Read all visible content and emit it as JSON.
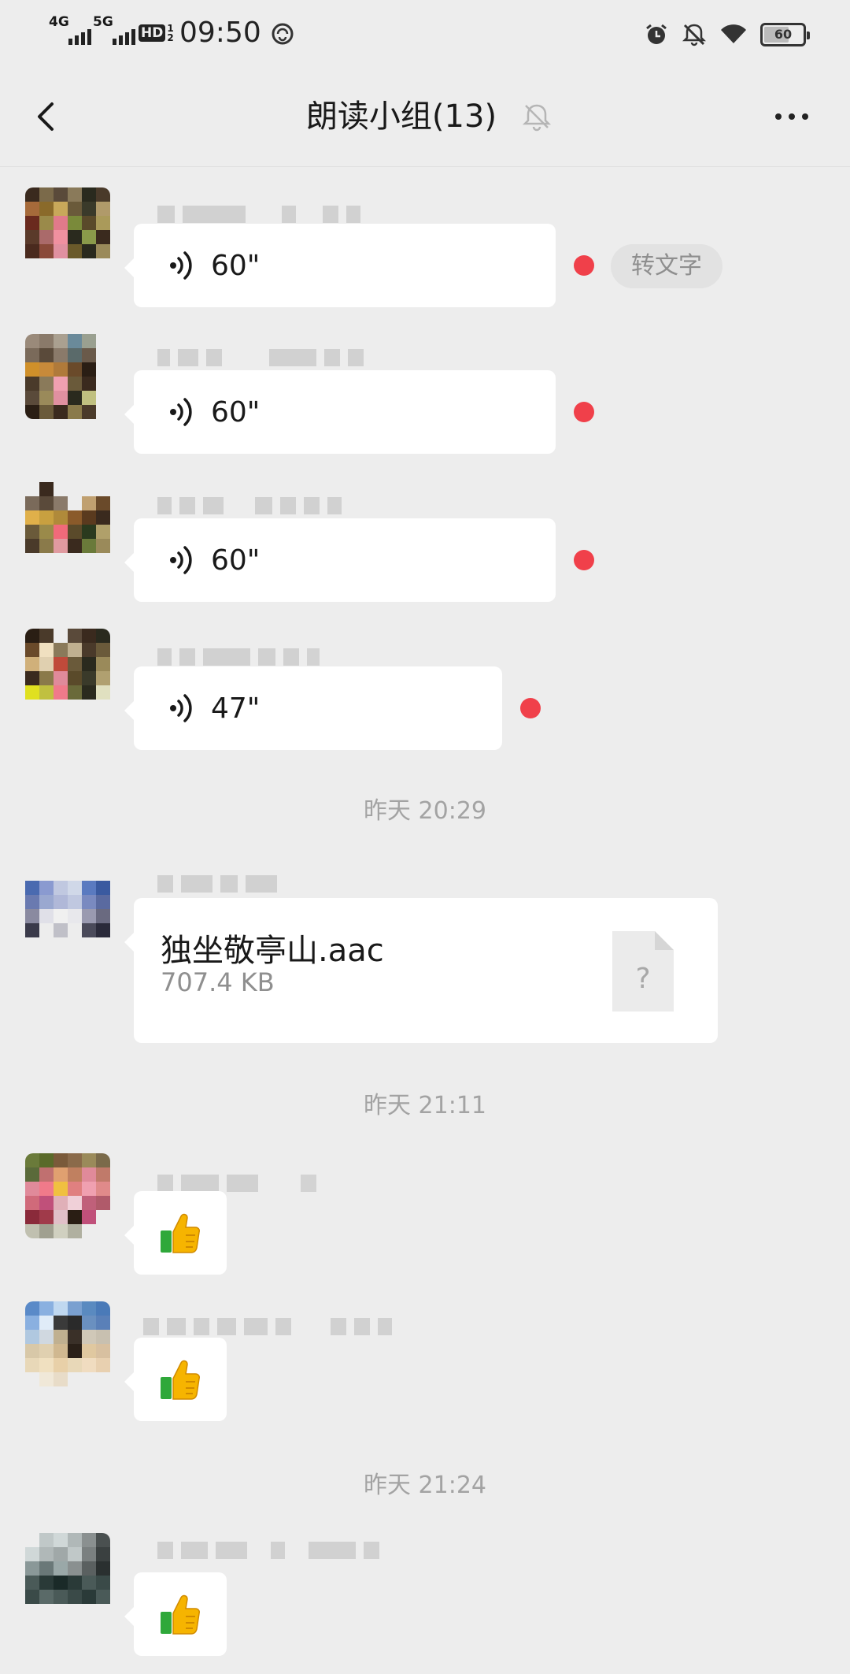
{
  "status_bar": {
    "net1": "4G",
    "net2": "5G",
    "hd": "HD",
    "hd_fraction_top": "1",
    "hd_fraction_bottom": "2",
    "time": "09:50",
    "battery_level": "60",
    "icons": [
      "alarm-icon",
      "notifications-off-icon",
      "wifi-icon",
      "battery-icon"
    ]
  },
  "nav": {
    "title": "朗读小组(13)",
    "back_icon": "chevron-left-icon",
    "mute_icon": "bell-off-icon",
    "more_icon": "more-dots-icon"
  },
  "messages": [
    {
      "type": "voice",
      "duration": "60\"",
      "unread": true,
      "action": "转文字"
    },
    {
      "type": "voice",
      "duration": "60\"",
      "unread": true
    },
    {
      "type": "voice",
      "duration": "60\"",
      "unread": true
    },
    {
      "type": "voice",
      "duration": "47\"",
      "unread": true
    },
    {
      "type": "timestamp",
      "text": "昨天 20:29"
    },
    {
      "type": "file",
      "file_name": "独坐敬亭山.aac",
      "file_size": "707.4 KB",
      "file_icon_glyph": "?"
    },
    {
      "type": "timestamp",
      "text": "昨天 21:11"
    },
    {
      "type": "emoji",
      "emoji": "thumbs-up-icon"
    },
    {
      "type": "emoji",
      "emoji": "thumbs-up-icon"
    },
    {
      "type": "timestamp",
      "text": "昨天 21:24"
    },
    {
      "type": "emoji",
      "emoji": "thumbs-up-icon"
    }
  ],
  "colors": {
    "background": "#ededed",
    "bubble": "#ffffff",
    "unread_dot": "#f0404a",
    "timestamp_text": "#a3a3a3"
  }
}
